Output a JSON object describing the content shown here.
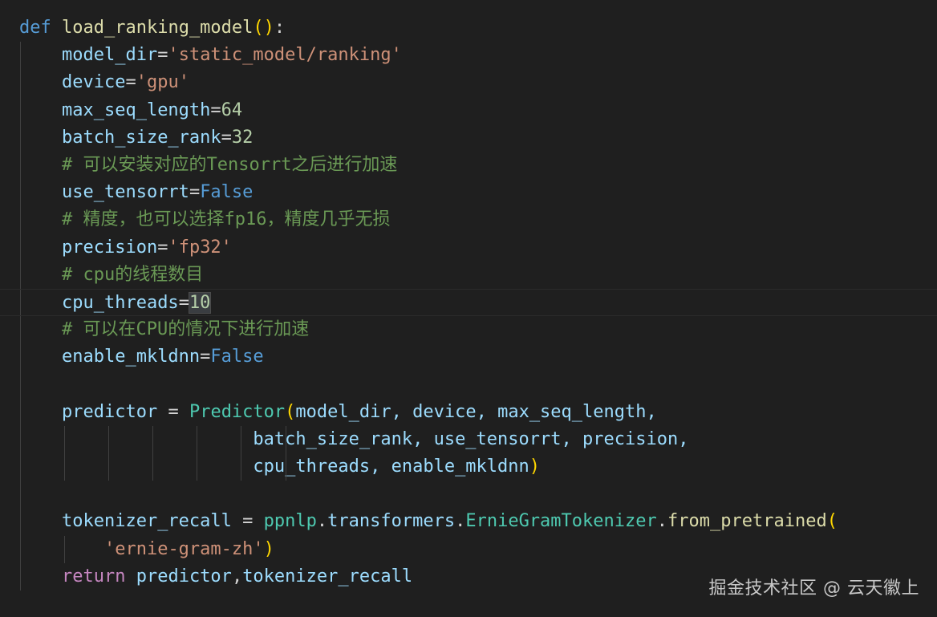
{
  "code": {
    "l1": {
      "kw": "def",
      "fn": "load_ranking_model",
      "open": "(",
      "close": ")",
      "colon": ":"
    },
    "l2": {
      "var": "model_dir",
      "eq": "=",
      "val": "'static_model/ranking'"
    },
    "l3": {
      "var": "device",
      "eq": "=",
      "val": "'gpu'"
    },
    "l4": {
      "var": "max_seq_length",
      "eq": "=",
      "val": "64"
    },
    "l5": {
      "var": "batch_size_rank",
      "eq": "=",
      "val": "32"
    },
    "l6": {
      "comment": "# 可以安装对应的Tensorrt之后进行加速"
    },
    "l7": {
      "var": "use_tensorrt",
      "eq": "=",
      "val": "False"
    },
    "l8": {
      "comment": "# 精度，也可以选择fp16，精度几乎无损"
    },
    "l9": {
      "var": "precision",
      "eq": "=",
      "val": "'fp32'"
    },
    "l10": {
      "comment": "# cpu的线程数目"
    },
    "l11": {
      "var": "cpu_threads",
      "eq": "=",
      "val": "10"
    },
    "l12": {
      "comment": "# 可以在CPU的情况下进行加速"
    },
    "l13": {
      "var": "enable_mkldnn",
      "eq": "=",
      "val": "False"
    },
    "l15": {
      "var": "predictor",
      "eq": " = ",
      "cls": "Predictor",
      "open": "(",
      "args": "model_dir, device, max_seq_length,"
    },
    "l16": {
      "args": "batch_size_rank, use_tensorrt, precision,"
    },
    "l17": {
      "args": "cpu_threads, enable_mkldnn",
      "close": ")"
    },
    "l19": {
      "var": "tokenizer_recall",
      "eq": " = ",
      "mod": "ppnlp",
      "dot1": ".",
      "attr1": "transformers",
      "dot2": ".",
      "cls": "ErnieGramTokenizer",
      "dot3": ".",
      "fn": "from_pretrained",
      "open": "("
    },
    "l20": {
      "str": "'ernie-gram-zh'",
      "close": ")"
    },
    "l21": {
      "kw": "return",
      "val1": "predictor",
      "comma": ",",
      "val2": "tokenizer_recall"
    }
  },
  "watermark": "掘金技术社区 @ 云天徽上"
}
